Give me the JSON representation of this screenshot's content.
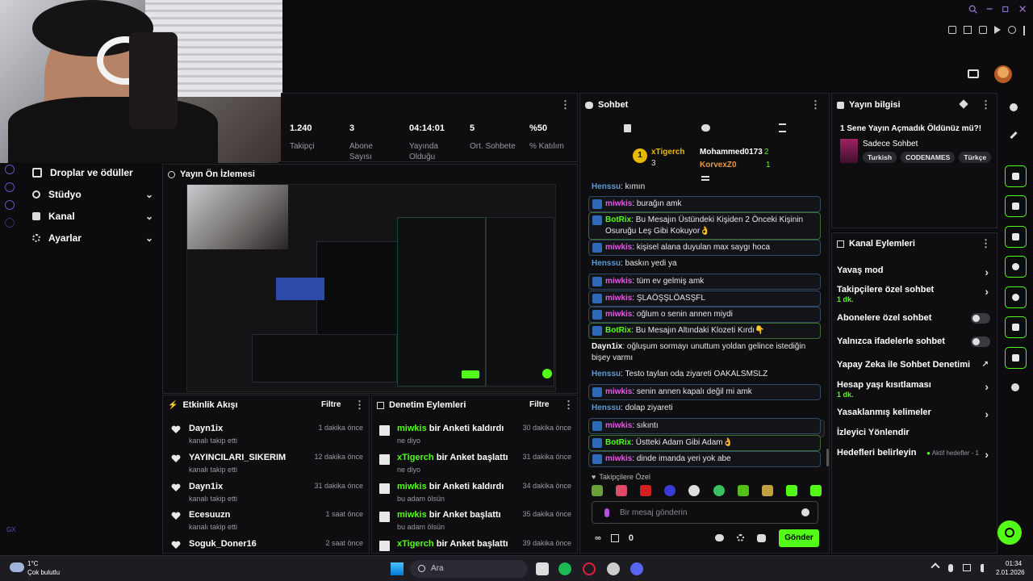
{
  "nav": {
    "items": [
      {
        "label": "Droplar ve ödüller"
      },
      {
        "label": "Stüdyo"
      },
      {
        "label": "Kanal"
      },
      {
        "label": "Ayarlar"
      }
    ],
    "bottom_label": "GX"
  },
  "stats": [
    {
      "value": "1.240",
      "label": "Takipçi"
    },
    {
      "value": "3",
      "label": "Abone Sayısı"
    },
    {
      "value": "04:14:01",
      "label": "Yayında Olduğu"
    },
    {
      "value": "5",
      "label": "Ort. Sohbete"
    },
    {
      "value": "%50",
      "label": "% Katılım"
    }
  ],
  "preview": {
    "title": "Yayın Ön İzlemesi"
  },
  "activity": {
    "title": "Etkinlik Akışı",
    "filter": "Filtre",
    "items": [
      {
        "name": "Dayn1ix",
        "sub": "kanalı takip etti",
        "time": "1 dakika önce"
      },
      {
        "name": "YAYINCILARI_SIKERIM",
        "sub": "kanalı takip etti",
        "time": "12 dakika önce"
      },
      {
        "name": "Dayn1ix",
        "sub": "kanalı takip etti",
        "time": "31 dakika önce"
      },
      {
        "name": "Ecesuuzn",
        "sub": "kanalı takip etti",
        "time": "1 saat önce"
      },
      {
        "name": "Soguk_Doner16",
        "sub": "",
        "time": "2 saat önce"
      }
    ]
  },
  "moderation": {
    "title": "Denetim Eylemleri",
    "filter": "Filtre",
    "items": [
      {
        "user": "miwkis",
        "action": "bir Anketi kaldırdı",
        "sub": "ne diyo",
        "time": "30 dakika önce"
      },
      {
        "user": "xTigerch",
        "action": "bir Anket başlattı",
        "sub": "ne diyo",
        "time": "31 dakika önce"
      },
      {
        "user": "miwkis",
        "action": "bir Anketi kaldırdı",
        "sub": "bu adam ölsün",
        "time": "34 dakika önce"
      },
      {
        "user": "miwkis",
        "action": "bir Anket başlattı",
        "sub": "bu adam ölsün",
        "time": "35 dakika önce"
      },
      {
        "user": "xTigerch",
        "action": "bir Anket başlattı",
        "sub": "",
        "time": "39 dakika önce"
      }
    ]
  },
  "chat": {
    "title": "Sohbet",
    "leaderboard": {
      "rank1": {
        "name": "xTigerch",
        "count": "3",
        "rank": "1"
      },
      "rank2": {
        "name": "Mohammed0173",
        "count": "2"
      },
      "rank3": {
        "name": "KorvexZ0",
        "count": "1"
      }
    },
    "messages": [
      {
        "user": "Henssu",
        "text": ": kımın",
        "color": "#5b9bd5",
        "boxed": false
      },
      {
        "user": "miwkis",
        "text": ": burağın amk",
        "color": "#e05de0",
        "boxed": true
      },
      {
        "user": "BotRix",
        "text": ": Bu Mesajın Üstündeki Kişiden 2 Önceki Kişinin Osuruğu Leş Gibi Kokuyor👌",
        "color": "#53fc18",
        "boxed": true
      },
      {
        "user": "miwkis",
        "text": ": kişisel alana duyulan max saygı hoca",
        "color": "#e05de0",
        "boxed": true
      },
      {
        "user": "Henssu",
        "text": ": baskın yedi ya",
        "color": "#5b9bd5",
        "boxed": false
      },
      {
        "user": "miwkis",
        "text": ": tüm ev gelmiş amk",
        "color": "#e05de0",
        "boxed": true
      },
      {
        "user": "miwkis",
        "text": ": ŞLAÖŞŞLÖASŞFL",
        "color": "#e05de0",
        "boxed": true
      },
      {
        "user": "miwkis",
        "text": ": oğlum o senin annen miydi",
        "color": "#e05de0",
        "boxed": true
      },
      {
        "user": "BotRix",
        "text": ": Bu Mesajın Altındaki Klozeti Kırdı👇",
        "color": "#53fc18",
        "boxed": true
      },
      {
        "user": "Dayn1ix",
        "text": ": oğluşum sormayı unuttum yoldan gelince istediğin bişey varmı",
        "color": "#ffffff",
        "boxed": false
      },
      {
        "user": "Henssu",
        "text": ": Testo taylan oda ziyareti OAKALSMSLZ",
        "color": "#5b9bd5",
        "boxed": false
      },
      {
        "user": "miwkis",
        "text": ": senin annen kapalı değil mi amk",
        "color": "#e05de0",
        "boxed": true
      },
      {
        "user": "Henssu",
        "text": ": dolap ziyareti",
        "color": "#5b9bd5",
        "boxed": false
      },
      {
        "user": "miwkis",
        "text": ": sıkıntı",
        "color": "#e05de0",
        "boxed": true
      },
      {
        "user": "BotRix",
        "text": ": Üstteki Adam Gibi Adam👌",
        "color": "#53fc18",
        "boxed": true
      },
      {
        "user": "miwkis",
        "text": ": dinde imanda yeri yok abe",
        "color": "#e05de0",
        "boxed": true
      }
    ],
    "followers_only": "Takipçilere Özel",
    "input_placeholder": "Bir mesaj gönderin",
    "points": "0",
    "send_label": "Gönder"
  },
  "stream_info": {
    "title": "Yayın bilgisi",
    "stream_title": "1 Sene Yayın Açmadık Öldünüz mü?!",
    "category": "Sadece Sohbet",
    "tags": [
      "Turkish",
      "CODENAMES",
      "Türkçe"
    ]
  },
  "channel_actions": {
    "title": "Kanal Eylemleri",
    "items": [
      {
        "label": "Yavaş mod",
        "sub": "",
        "control": "chevron"
      },
      {
        "label": "Takipçilere özel sohbet",
        "sub": "1 dk.",
        "control": "chevron"
      },
      {
        "label": "Abonelere özel sohbet",
        "sub": "",
        "control": "toggle"
      },
      {
        "label": "Yalnızca ifadelerle sohbet",
        "sub": "",
        "control": "toggle"
      },
      {
        "label": "Yapay Zeka ile Sohbet Denetimi",
        "sub": "",
        "control": "external"
      },
      {
        "label": "Hesap yaşı kısıtlaması",
        "sub": "1 dk.",
        "control": "chevron"
      },
      {
        "label": "Yasaklanmış kelimeler",
        "sub": "",
        "control": "chevron"
      },
      {
        "label": "İzleyici Yönlendir",
        "sub": "",
        "control": "none"
      },
      {
        "label": "Hedefleri belirleyin",
        "sub": "",
        "control": "goal"
      }
    ],
    "goal_status": "Aktif hedefler - 1"
  },
  "taskbar": {
    "weather_temp": "1°C",
    "weather_desc": "Çok bulutlu",
    "search_label": "Ara",
    "time": "01:34",
    "date": "2.01.2026"
  },
  "colors": {
    "accent": "#53fc18",
    "background": "#0e0e10"
  }
}
